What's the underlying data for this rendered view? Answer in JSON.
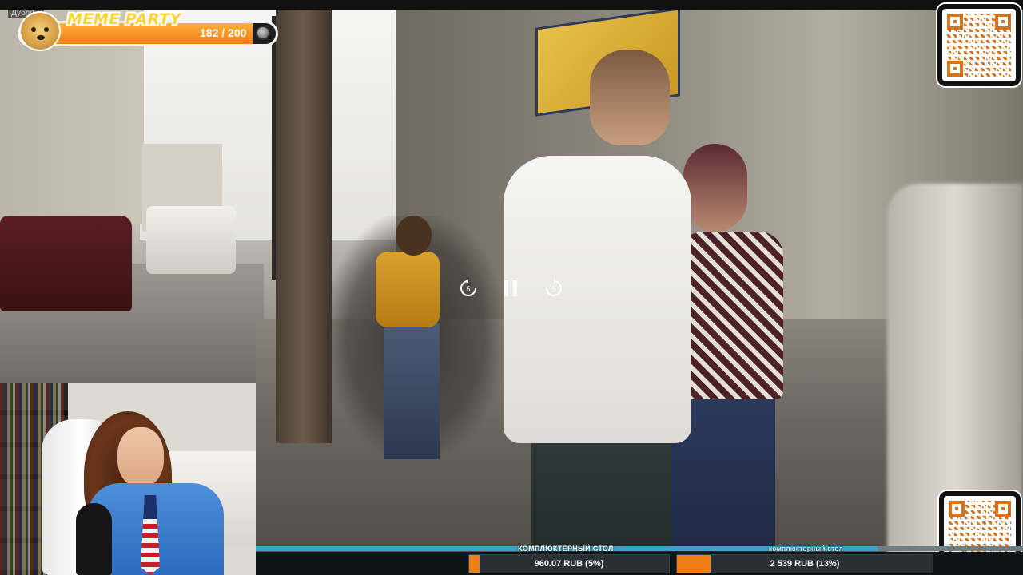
{
  "overlay": {
    "title_tag": "Дубля...",
    "meme": {
      "title": "MEME PARTY",
      "count": "182 / 200",
      "progress": 0.91
    }
  },
  "player": {
    "rewind_label": "5",
    "forward_label": "5",
    "state": "paused"
  },
  "donations": {
    "left": {
      "caption": "КОМПЛЮКТЕРНЫЙ СТОЛ",
      "amount": "960.07 RUB (5%)",
      "progress": 0.05
    },
    "right": {
      "caption": "комплюктерный стол",
      "amount": "2 539 RUB (13%)",
      "progress": 0.13
    },
    "ticker_progress": 0.81
  },
  "colors": {
    "accent": "#f07d14",
    "meme_title": "#ffd23a",
    "ticker": "#3aa3c8"
  }
}
